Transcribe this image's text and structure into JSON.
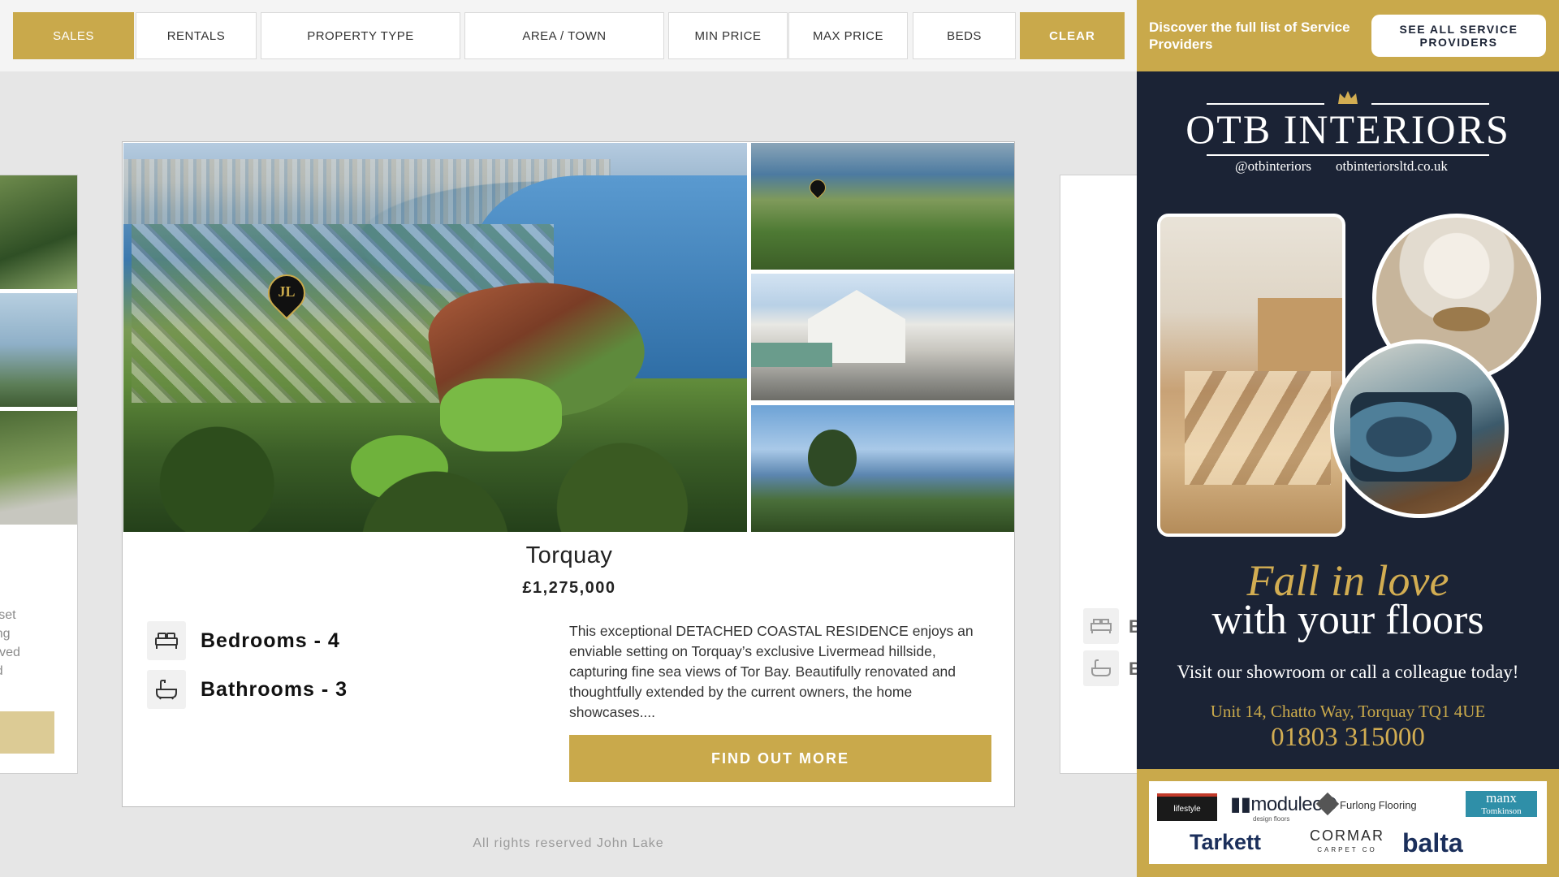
{
  "filters": {
    "sales": "SALES",
    "rentals": "RENTALS",
    "property_type": "PROPERTY TYPE",
    "area_town": "AREA / TOWN",
    "min_price": "MIN PRICE",
    "max_price": "MAX PRICE",
    "beds": "BEDS",
    "clear": "CLEAR"
  },
  "ghost_left": {
    "text_lines": [
      "NCE set",
      "tunning",
      "d a loved",
      "ached"
    ]
  },
  "ghost_right": {
    "letters": [
      "B",
      "B"
    ]
  },
  "listing": {
    "title": "Torquay",
    "price": "£1,275,000",
    "pin_letters": "JL",
    "bedrooms": "Bedrooms - 4",
    "bathrooms": "Bathrooms - 3",
    "description": "This exceptional DETACHED COASTAL RESIDENCE enjoys an enviable setting on Torquay’s exclusive Livermead hillside, capturing fine sea views of Tor Bay. Beautifully renovated and thoughtfully extended by the current owners, the home showcases....",
    "cta": "FIND OUT MORE"
  },
  "footer": {
    "text": "All rights reserved John Lake"
  },
  "service_providers": {
    "text": "Discover the full list of Service Providers",
    "button": "SEE ALL SERVICE PROVIDERS"
  },
  "ad": {
    "brand": "OTB INTERIORS",
    "instagram": "@otbinteriors",
    "website": "otbinteriorsltd.co.uk",
    "headline_1": "Fall in love",
    "headline_2": "with your floors",
    "visit": "Visit our showroom or call a colleague today!",
    "address": "Unit 14, Chatto Way, Torquay TQ1 4UE",
    "phone": "01803 315000",
    "partners": {
      "lifestyle": "lifestyle",
      "moduleo": "▮▮moduleo®",
      "moduleo_sub": "design floors",
      "furlong": "Furlong Flooring",
      "manx": "manx",
      "manx_sub": "Tomkinson",
      "tarkett": "Tarkett",
      "cormar": "CORMAR",
      "cormar_sub": "CARPET CO",
      "balta": "balta"
    }
  },
  "colors": {
    "gold": "#c9a94b",
    "navy": "#1b2335",
    "background": "#e6e6e6"
  }
}
